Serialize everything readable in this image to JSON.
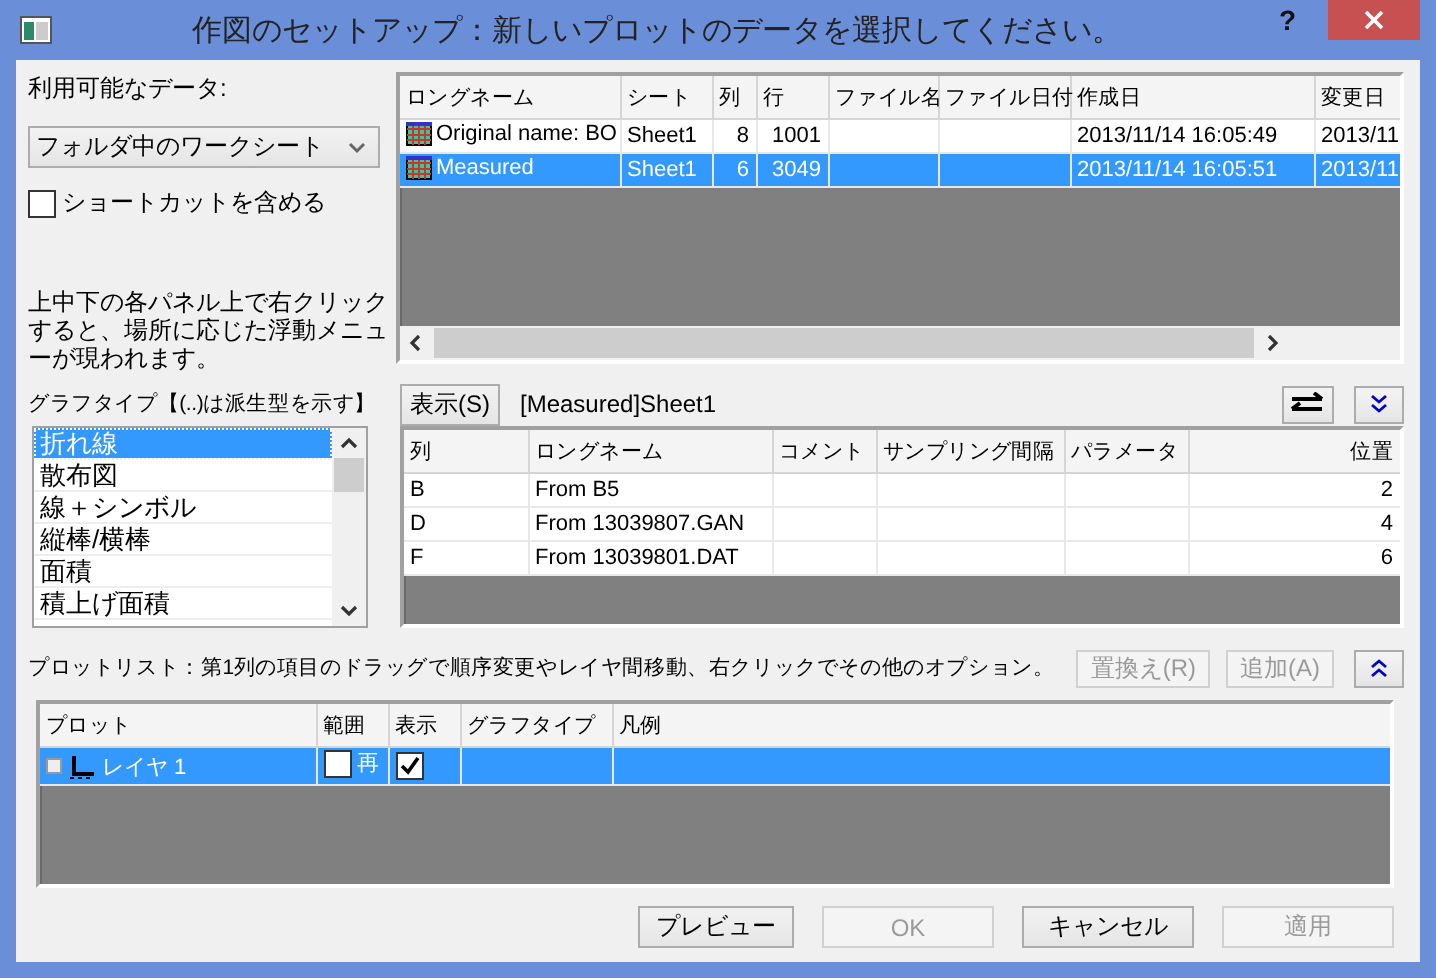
{
  "window": {
    "title": "作図のセットアップ：新しいプロットのデータを選択してください。",
    "help": "?"
  },
  "data_source": {
    "label": "利用可能なデータ:",
    "dropdown": "フォルダ中のワークシート",
    "include_shortcuts": {
      "label": "ショートカットを含める",
      "checked": false
    },
    "hint": "上中下の各パネル上で右クリックすると、場所に応じた浮動メニューが現われます。"
  },
  "worksheets": {
    "columns": [
      "ロングネーム",
      "シート",
      "列",
      "行",
      "ファイル名",
      "ファイル日付",
      "作成日",
      "変更日"
    ],
    "rows": [
      {
        "cells": [
          "Original name: BO",
          "Sheet1",
          "8",
          "1001",
          "",
          "",
          "2013/11/14  16:05:49",
          "2013/11"
        ],
        "selected": false
      },
      {
        "cells": [
          "Measured",
          "Sheet1",
          "6",
          "3049",
          "",
          "",
          "2013/11/14  16:05:51",
          "2013/11"
        ],
        "selected": true
      }
    ]
  },
  "graph_types": {
    "label": "グラフタイプ【(..)は派生型を示す】",
    "items": [
      {
        "label": "折れ線",
        "selected": true
      },
      {
        "label": "散布図",
        "selected": false
      },
      {
        "label": "線＋シンボル",
        "selected": false
      },
      {
        "label": "縦棒/横棒",
        "selected": false
      },
      {
        "label": "面積",
        "selected": false
      },
      {
        "label": "積上げ面積",
        "selected": false
      }
    ]
  },
  "show_button": "表示(S)",
  "sheet_label": "[Measured]Sheet1",
  "columns_table": {
    "columns": [
      "列",
      "ロングネーム",
      "コメント",
      "サンプリング間隔",
      "パラメータ",
      "位置"
    ],
    "rows": [
      {
        "cells": [
          "B",
          "From B5",
          "",
          "",
          "",
          "2"
        ]
      },
      {
        "cells": [
          "D",
          "From 13039807.GAN",
          "",
          "",
          "",
          "4"
        ]
      },
      {
        "cells": [
          "F",
          "From 13039801.DAT",
          "",
          "",
          "",
          "6"
        ]
      }
    ]
  },
  "plot_list": {
    "label": "プロットリスト：第1列の項目のドラッグで順序変更やレイヤ間移動、右クリックでその他のオプション。",
    "buttons": [
      {
        "label": "置換え(R)",
        "disabled": true
      },
      {
        "label": "追加(A)",
        "disabled": true
      }
    ],
    "columns": [
      "プロット",
      "範囲",
      "表示",
      "グラフタイプ",
      "凡例"
    ],
    "rows": [
      {
        "label": "レイヤ 1",
        "range": "再",
        "range_checked": false,
        "show_checked": true,
        "selected": true
      }
    ]
  },
  "buttons": [
    {
      "label": "プレビュー",
      "disabled": false
    },
    {
      "label": "OK",
      "disabled": true
    },
    {
      "label": "キャンセル",
      "disabled": false
    },
    {
      "label": "適用",
      "disabled": true
    }
  ]
}
